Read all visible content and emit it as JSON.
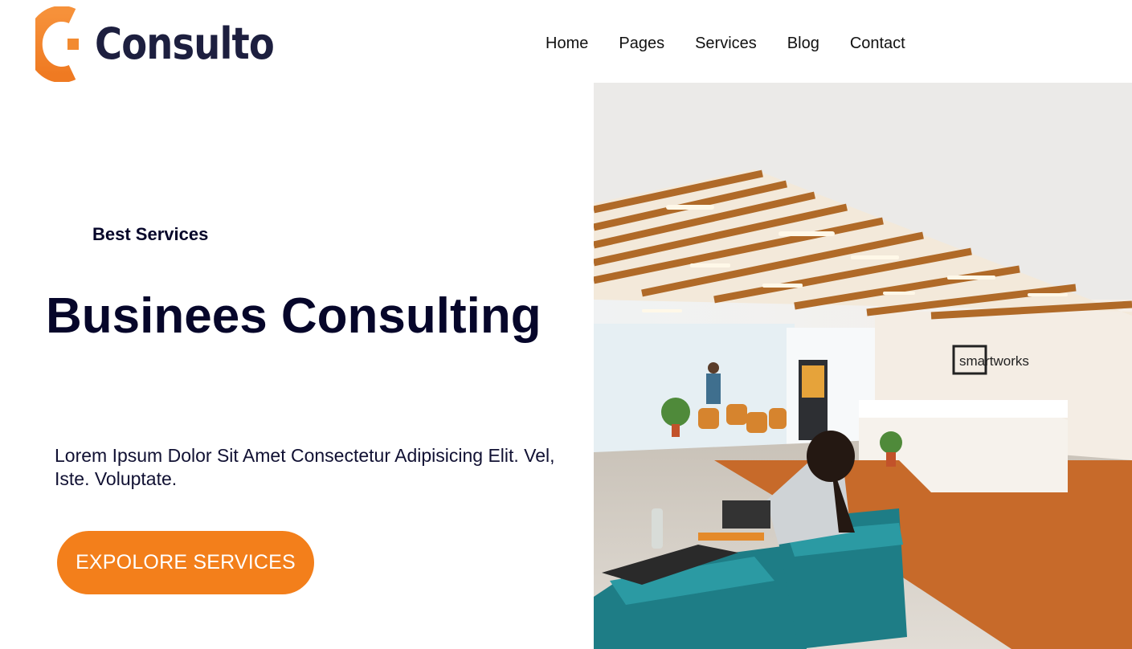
{
  "brand": {
    "name": "Consulto",
    "logo_icon": "c-ring-logo-icon",
    "accent_color": "#f37f1b",
    "text_color": "#1d1f3f"
  },
  "nav": {
    "items": [
      {
        "label": "Home"
      },
      {
        "label": "Pages"
      },
      {
        "label": "Services"
      },
      {
        "label": "Blog"
      },
      {
        "label": "Contact"
      }
    ]
  },
  "hero": {
    "eyebrow": "Best Services",
    "title": "Businees Consulting",
    "description": "Lorem Ipsum Dolor Sit Amet Consectetur Adipisicing Elit. Vel, Iste. Voluptate.",
    "cta_label": "EXPOLORE SERVICES",
    "image": {
      "sign_text": "smartworks"
    }
  }
}
